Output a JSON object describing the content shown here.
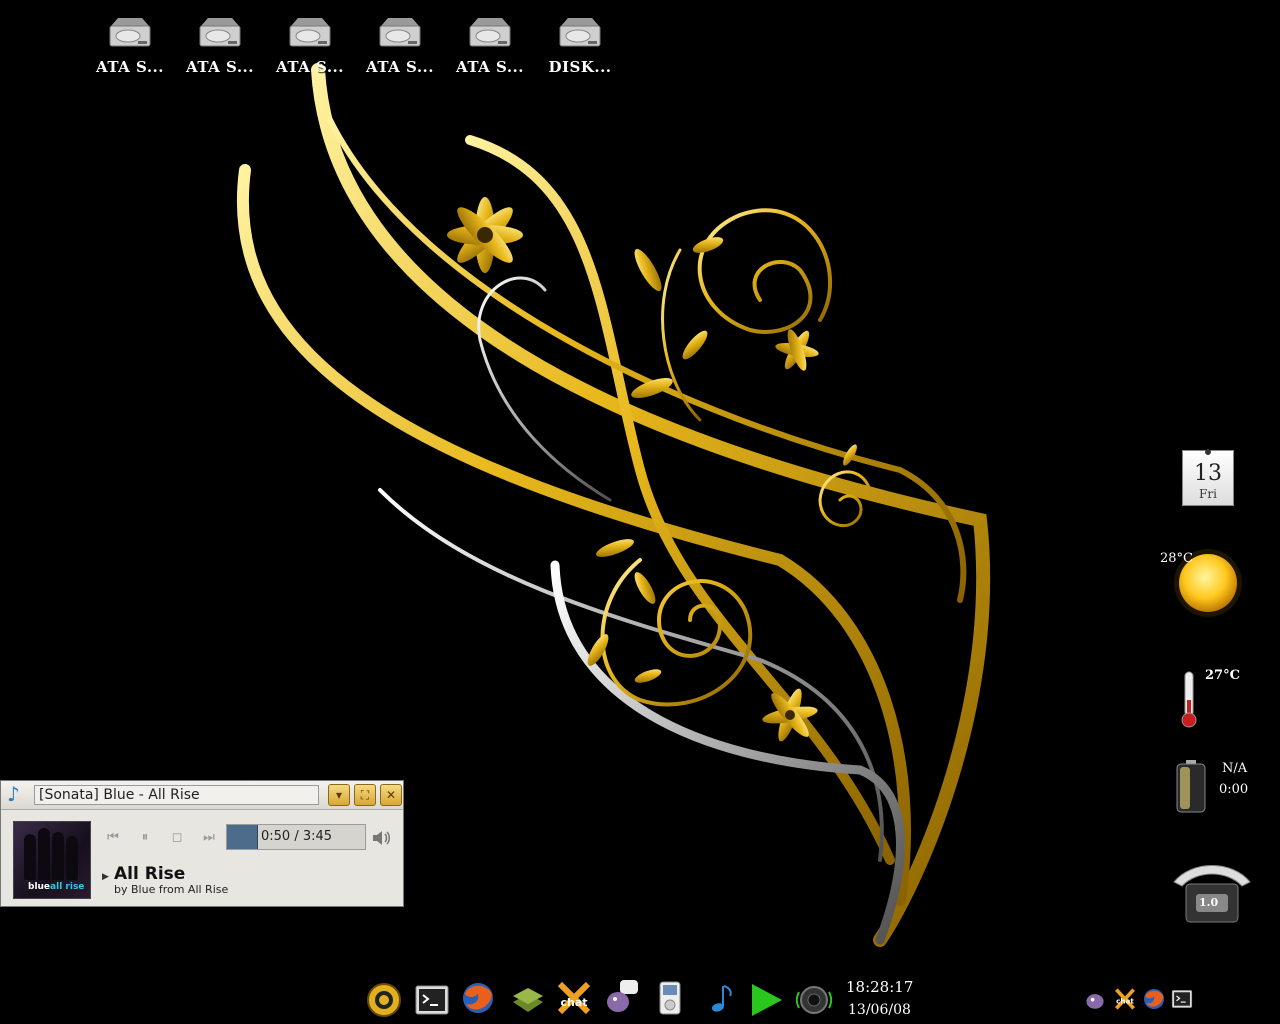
{
  "desktop": {
    "icons": [
      {
        "label": "ATA S...",
        "icon": "hard-drive-icon"
      },
      {
        "label": "ATA S...",
        "icon": "hard-drive-icon"
      },
      {
        "label": "ATA S...",
        "icon": "hard-drive-icon"
      },
      {
        "label": "ATA S...",
        "icon": "hard-drive-icon"
      },
      {
        "label": "ATA S...",
        "icon": "hard-drive-icon"
      },
      {
        "label": "DISK...",
        "icon": "hard-drive-icon"
      }
    ]
  },
  "widgets": {
    "calendar": {
      "day": "13",
      "weekday": "Fri"
    },
    "weather": {
      "temp": "28°C",
      "icon": "sun-icon"
    },
    "thermometer": {
      "temp": "27°C"
    },
    "battery": {
      "status": "N/A",
      "time": "0:00"
    },
    "meter": {
      "value": "1.0"
    }
  },
  "player": {
    "window_title": "[Sonata] Blue - All Rise",
    "elapsed_total": "0:50 / 3:45",
    "progress_fraction": 0.22,
    "song": "All Rise",
    "details": "by Blue from All Rise",
    "album_caption_a": "blue",
    "album_caption_b": "all rise"
  },
  "taskbar": {
    "launchers": [
      "system-menu-icon",
      "terminal-icon",
      "firefox-icon",
      "books-icon",
      "xchat-icon",
      "pidgin-icon",
      "ipod-icon",
      "music-note-icon",
      "play-icon",
      "speaker-icon"
    ],
    "time": "18:28:17",
    "date": "13/06/08",
    "tray": [
      "pidgin-tray-icon",
      "xchat-tray-icon",
      "firefox-tray-icon",
      "terminal-tray-icon"
    ]
  },
  "colors": {
    "gold": "#e8b81c",
    "silver": "#b0b0b0",
    "accent": "#4d6b8a"
  }
}
